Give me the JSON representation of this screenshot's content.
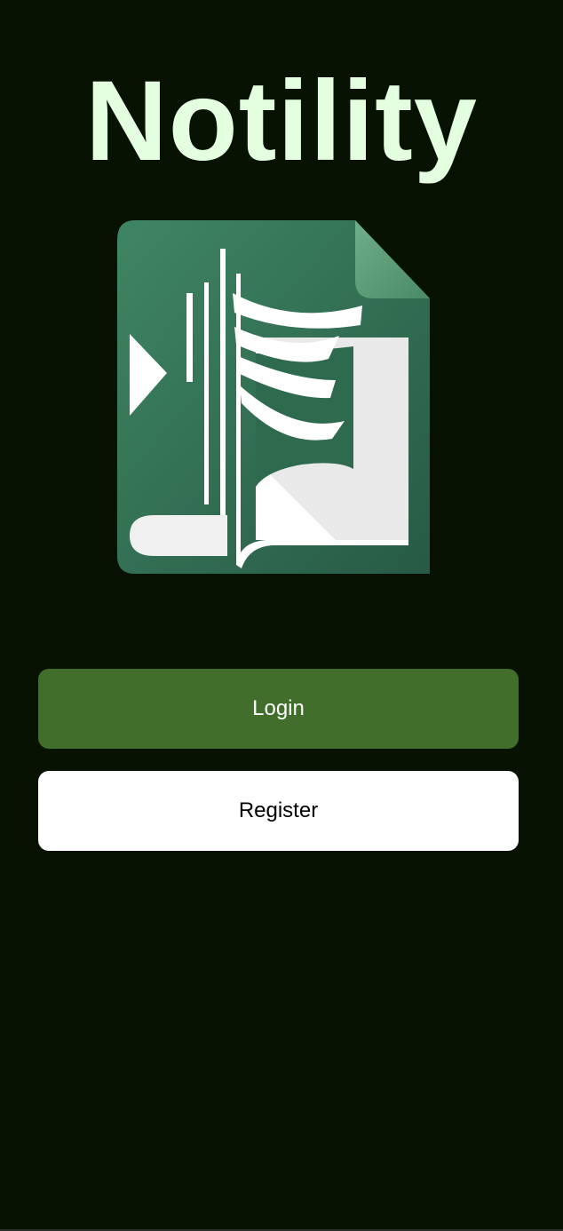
{
  "app": {
    "title": "Notility"
  },
  "logo": {
    "icon": "document-book-logo-icon"
  },
  "actions": {
    "login_label": "Login",
    "register_label": "Register"
  },
  "colors": {
    "background": "#071202",
    "title": "#e3ffe0",
    "login_button": "#416e2b",
    "register_button": "#ffffff",
    "logo_green": "#3b7a57"
  }
}
